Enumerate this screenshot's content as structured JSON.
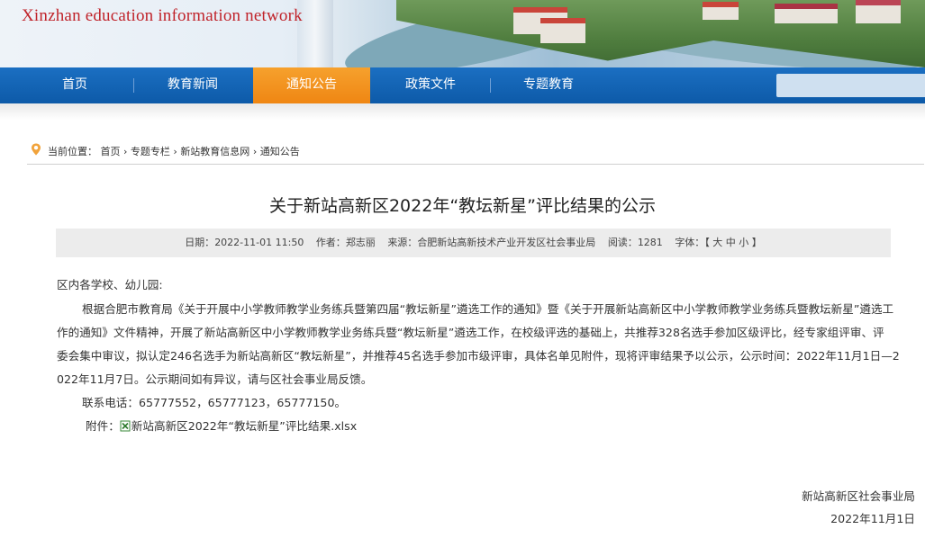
{
  "header": {
    "site_title": "Xinzhan education information network"
  },
  "nav": {
    "items": [
      {
        "label": "首页"
      },
      {
        "label": "教育新闻"
      },
      {
        "label": "通知公告",
        "active": true
      },
      {
        "label": "政策文件"
      },
      {
        "label": "专题教育"
      }
    ],
    "search_value": ""
  },
  "breadcrumb": {
    "prefix": "当前位置：",
    "items": [
      "首页",
      "专题专栏",
      "新站教育信息网",
      "通知公告"
    ],
    "separator": " › "
  },
  "article": {
    "title": "关于新站高新区2022年“教坛新星”评比结果的公示",
    "meta": {
      "date_label": "日期：",
      "date": "2022-11-01 11:50",
      "author_label": "作者：",
      "author": "郑志丽",
      "source_label": "来源：",
      "source": "合肥新站高新技术产业开发区社会事业局",
      "views_label": "阅读：",
      "views": "1281",
      "font_label": "字体：",
      "font_sizes": "【 大 中 小 】"
    },
    "salutation": "区内各学校、幼儿园:",
    "paragraph_lines": [
      "根据合肥市教育局《关于开展中小学教师教学业务练兵暨第四届“教坛新星”遴选工作的通知》暨《关于开展新站高新区中小学教师教学业务练兵暨教坛新星”遴选工",
      "作的通知》文件精神，开展了新站高新区中小学教师教学业务练兵暨“教坛新星”遴选工作，在校级评选的基础上，共推荐328名选手参加区级评比，经专家组评审、评",
      "委会集中审议，拟认定246名选手为新站高新区“教坛新星”，并推荐45名选手参加市级评审，具体名单见附件，现将评审结果予以公示，公示时间：2022年11月1日—2",
      "022年11月7日。公示期间如有异议，请与区社会事业局反馈。"
    ],
    "contact": "联系电话：65777552，65777123，65777150。",
    "attachment_label": "附件：",
    "attachment_name": "新站高新区2022年“教坛新星”评比结果.xlsx",
    "signature_org": "新站高新区社会事业局",
    "signature_date": "2022年11月1日"
  }
}
